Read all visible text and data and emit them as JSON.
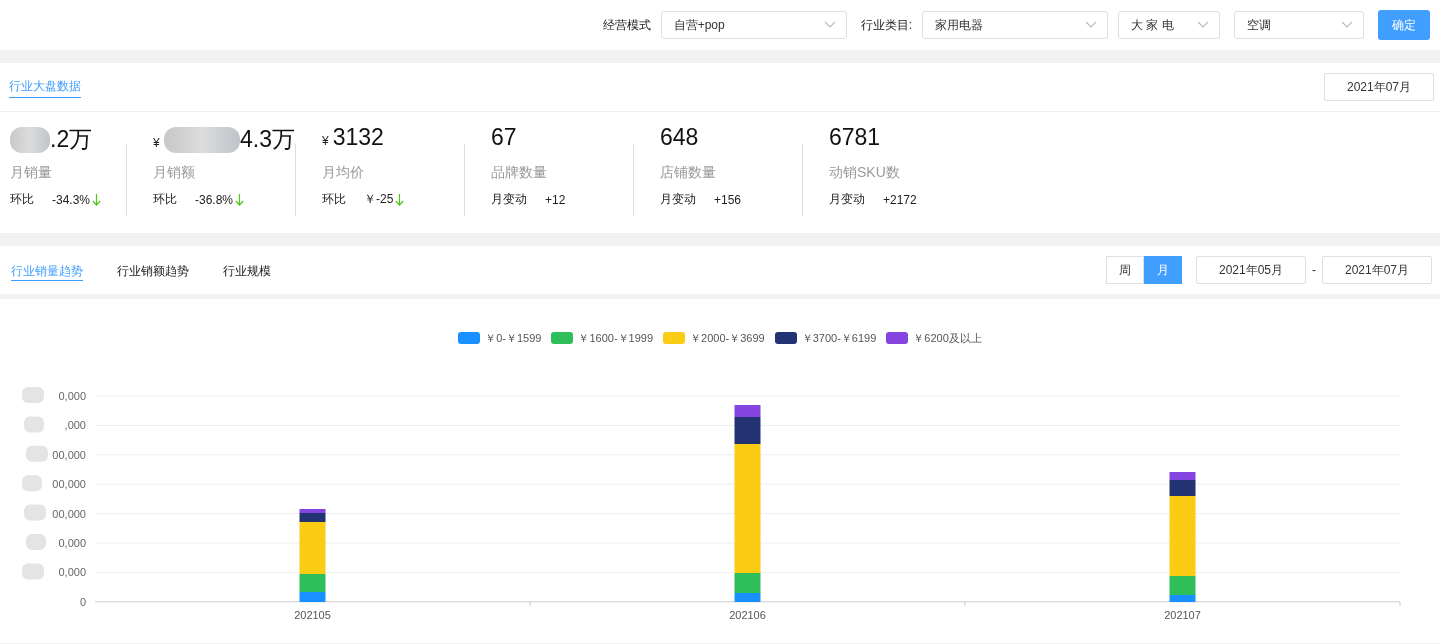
{
  "filters": [
    {
      "label": "经营模式",
      "value": "自营+pop",
      "kind": "wide"
    },
    {
      "label": "行业类目:",
      "value": "家用电器",
      "kind": "wide"
    },
    {
      "value": "大 家 电",
      "kind": "narrow"
    },
    {
      "value": "空调",
      "kind": "mid"
    }
  ],
  "confirm_button": "确定",
  "overview": {
    "tab": "行业大盘数据",
    "month": "2021年07月",
    "metrics": [
      {
        "value": ".2万",
        "blurred": true,
        "label": "月销量",
        "change_label": "环比",
        "change": "-34.3%",
        "down": true
      },
      {
        "prefix": "¥",
        "value": "4.3万",
        "blurred": true,
        "label": "月销额",
        "change_label": "环比",
        "change": "-36.8%",
        "down": true
      },
      {
        "prefix": "¥",
        "value": "3132",
        "blurred": false,
        "label": "月均价",
        "change_label": "环比",
        "change": "￥-25",
        "down": true
      },
      {
        "value": "67",
        "blurred": false,
        "label": "品牌数量",
        "change_label": "月变动",
        "change": "+12",
        "down": false
      },
      {
        "value": "648",
        "blurred": false,
        "label": "店铺数量",
        "change_label": "月变动",
        "change": "+156",
        "down": false
      },
      {
        "value": "6781",
        "blurred": false,
        "label": "动销SKU数",
        "change_label": "月变动",
        "change": "+2172",
        "down": false
      }
    ]
  },
  "trend": {
    "tabs": [
      {
        "label": "行业销量趋势",
        "selected": true
      },
      {
        "label": "行业销额趋势",
        "selected": false
      },
      {
        "label": "行业规模",
        "selected": false
      }
    ],
    "period": [
      {
        "label": "周",
        "selected": false
      },
      {
        "label": "月",
        "selected": true
      }
    ],
    "start": "2021年05月",
    "separator": "-",
    "end": "2021年07月",
    "legend": [
      {
        "label": "￥0-￥1599",
        "color": "#1890ff"
      },
      {
        "label": "￥1600-￥1999",
        "color": "#2fbf5a"
      },
      {
        "label": "￥2000-￥3699",
        "color": "#facc14"
      },
      {
        "label": "￥3700-￥6199",
        "color": "#223273"
      },
      {
        "label": "￥6200及以上",
        "color": "#8543e0"
      }
    ],
    "y_ticks": [
      "0,000",
      ",000",
      "00,000",
      "00,000",
      "00,000",
      "0,000",
      "0,000",
      "0"
    ],
    "categories": [
      "202105",
      "202106",
      "202107"
    ]
  }
}
